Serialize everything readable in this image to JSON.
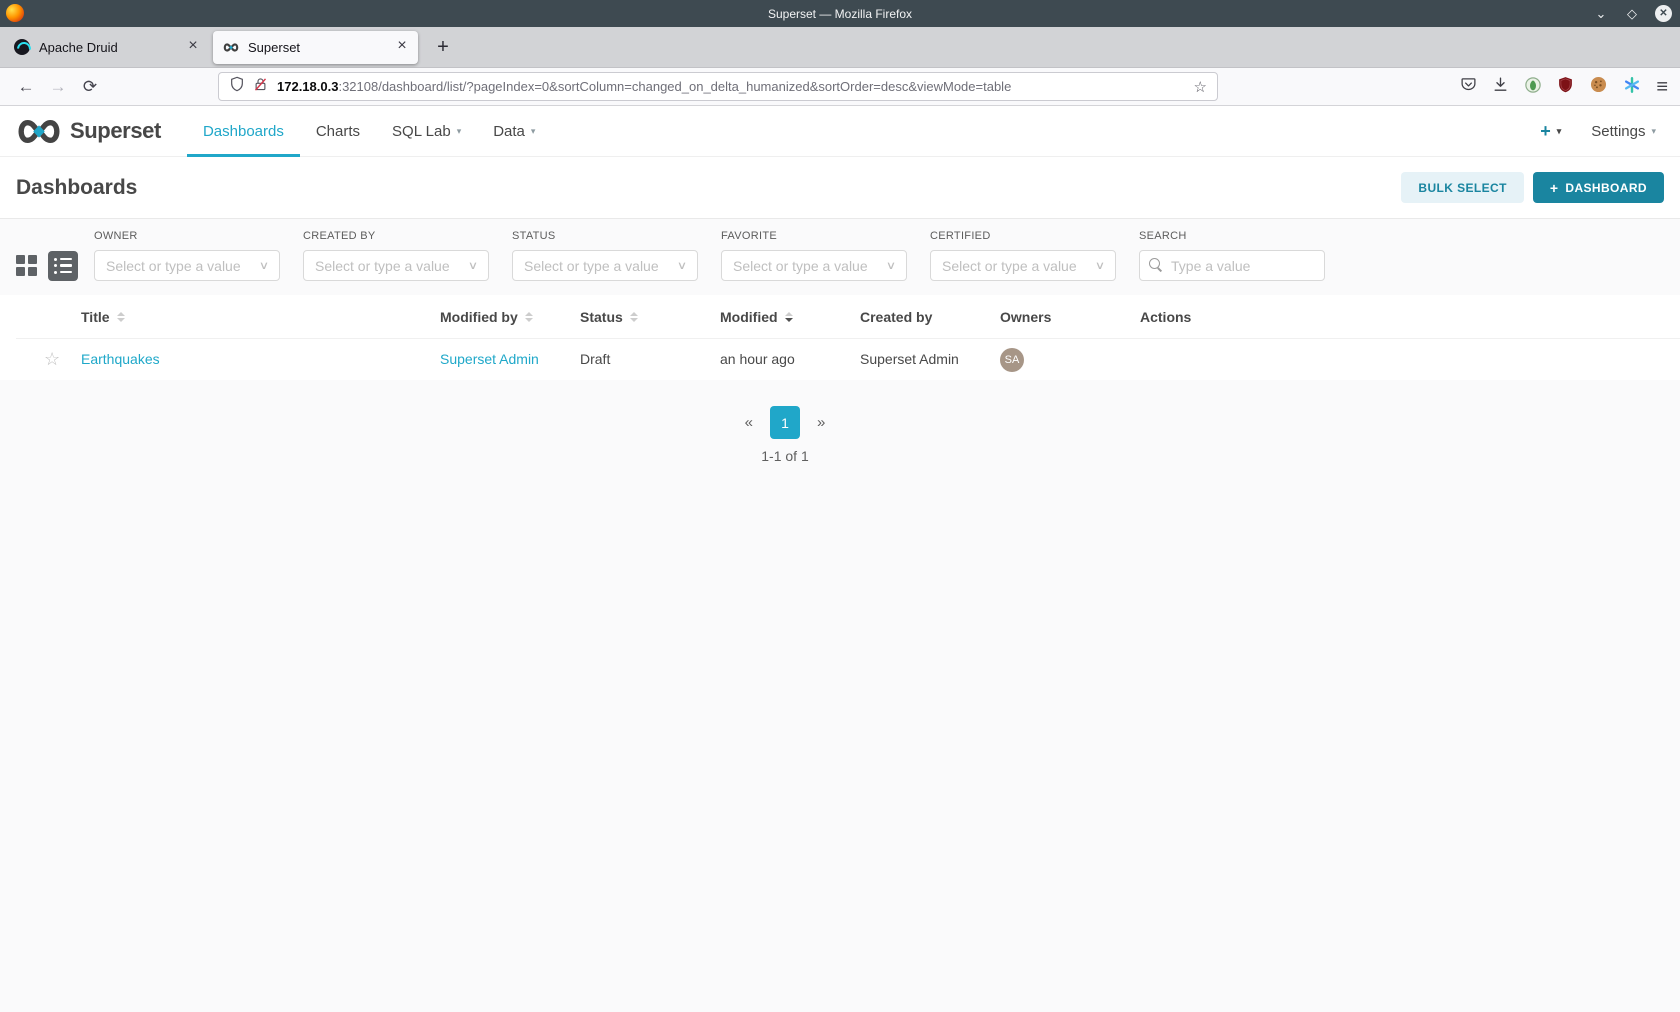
{
  "colors": {
    "accent": "#20A7C9",
    "primary_button": "#1A85A0",
    "bulk_button_bg": "#E6F2F7",
    "avatar_bg": "#A79687"
  },
  "window": {
    "title": "Superset — Mozilla Firefox",
    "tabs": [
      {
        "label": "Apache Druid"
      },
      {
        "label": "Superset"
      }
    ],
    "url": {
      "host": "172.18.0.3",
      "rest": ":32108/dashboard/list/?pageIndex=0&sortColumn=changed_on_delta_humanized&sortOrder=desc&viewMode=table"
    }
  },
  "navbar": {
    "brand": "Superset",
    "items": [
      {
        "label": "Dashboards"
      },
      {
        "label": "Charts"
      },
      {
        "label": "SQL Lab"
      },
      {
        "label": "Data"
      }
    ],
    "plus": "+",
    "settings": "Settings"
  },
  "header": {
    "title": "Dashboards",
    "bulk_select": "BULK SELECT",
    "new_dashboard": "DASHBOARD",
    "plus": "+"
  },
  "filters": [
    {
      "label": "OWNER",
      "placeholder": "Select or type a value"
    },
    {
      "label": "CREATED BY",
      "placeholder": "Select or type a value"
    },
    {
      "label": "STATUS",
      "placeholder": "Select or type a value"
    },
    {
      "label": "FAVORITE",
      "placeholder": "Select or type a value"
    },
    {
      "label": "CERTIFIED",
      "placeholder": "Select or type a value"
    },
    {
      "label": "SEARCH",
      "placeholder": "Type a value"
    }
  ],
  "table": {
    "columns": [
      "Title",
      "Modified by",
      "Status",
      "Modified",
      "Created by",
      "Owners",
      "Actions"
    ],
    "rows": [
      {
        "title": "Earthquakes",
        "modified_by": "Superset Admin",
        "status": "Draft",
        "modified": "an hour ago",
        "created_by": "Superset Admin",
        "owner_initials": "SA"
      }
    ]
  },
  "pagination": {
    "prev": "«",
    "page": "1",
    "next": "»",
    "count": "1-1 of 1"
  },
  "icons": {
    "close": "×",
    "caret": "▾",
    "chevron": "∨",
    "hamburger": "≡",
    "bookmark_star": "☆",
    "row_star": "☆",
    "win_min": "⌄",
    "win_max": "◇",
    "win_close": "✕",
    "back": "←",
    "forward": "→",
    "reload": "⟳"
  }
}
